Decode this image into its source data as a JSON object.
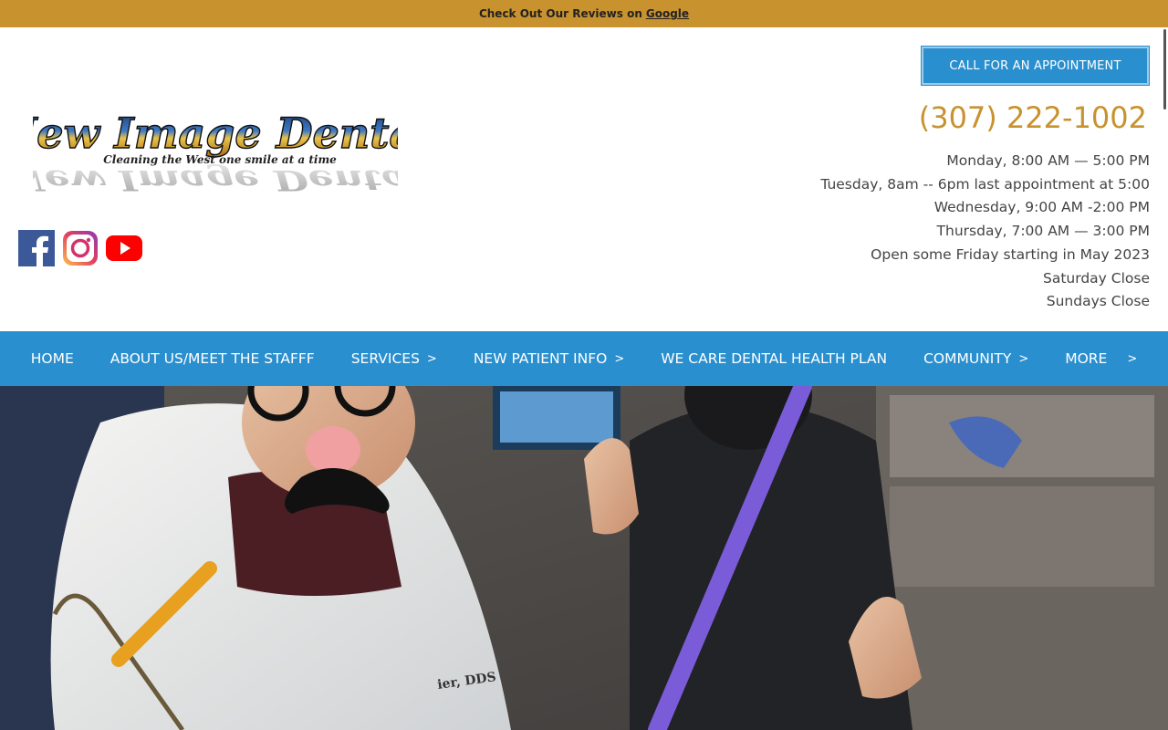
{
  "topbar": {
    "text": "Check Out Our Reviews on",
    "link": "Google",
    "bg_color": "#c8922e"
  },
  "appointment_button": {
    "label": "CALL FOR AN APPOINTMENT"
  },
  "logo": {
    "brand": "New Image Dental",
    "tagline": "Cleaning the West one smile at a time"
  },
  "social": {
    "items": [
      {
        "icon": "facebook-icon"
      },
      {
        "icon": "instagram-icon"
      },
      {
        "icon": "youtube-icon"
      }
    ]
  },
  "contact": {
    "phone": "(307) 222-1002",
    "accent_color": "#c8922e"
  },
  "hours": [
    "Monday, 8:00 AM — 5:00 PM",
    "Tuesday, 8am -- 6pm last appointment at 5:00",
    "Wednesday, 9:00 AM -2:00 PM ",
    "Thursday, 7:00 AM — 3:00 PM",
    "Open some Friday starting in May 2023 ",
    "Saturday Close",
    "Sundays Close"
  ],
  "nav": {
    "bg_color": "#2a8fcf",
    "items": [
      {
        "label": "HOME",
        "has_sub": false
      },
      {
        "label": "ABOUT US/MEET THE STAFFF",
        "has_sub": false
      },
      {
        "label": "SERVICES",
        "has_sub": true
      },
      {
        "label": "NEW PATIENT INFO",
        "has_sub": true
      },
      {
        "label": "WE CARE DENTAL HEALTH PLAN",
        "has_sub": false
      },
      {
        "label": "COMMUNITY",
        "has_sub": true
      },
      {
        "label": "MORE",
        "has_sub": true
      }
    ],
    "chevron": ">"
  },
  "hero": {
    "badge_text": "ier, DDS"
  }
}
